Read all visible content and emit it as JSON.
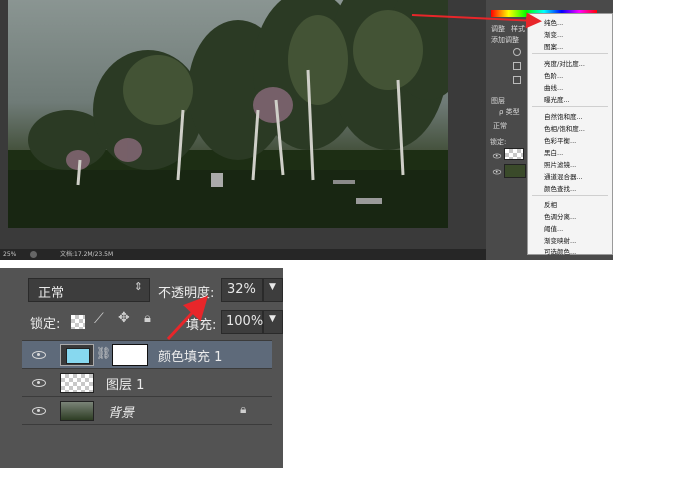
{
  "top_screenshot": {
    "status": {
      "zoom": "25%",
      "doc_info": "文档:17.2M/23.5M"
    },
    "panel": {
      "tab_adjust": "调整",
      "tab_style": "样式",
      "add_adjustment": "添加调整",
      "layers_tab": "图层",
      "kind_label": "ρ 类型",
      "blend_mini": "正常",
      "lock_mini": "锁定:"
    },
    "adjustment_menu": {
      "items": [
        "纯色...",
        "渐变...",
        "图案...",
        "亮度/对比度...",
        "色阶...",
        "曲线...",
        "曝光度...",
        "自然饱和度...",
        "色相/饱和度...",
        "色彩平衡...",
        "黑白...",
        "照片滤镜...",
        "通道混合器...",
        "颜色查找...",
        "反相",
        "色调分离...",
        "阈值...",
        "渐变映射...",
        "可选颜色..."
      ]
    }
  },
  "layers_panel": {
    "blend_mode": "正常",
    "opacity_label": "不透明度:",
    "opacity_value": "32%",
    "lock_label": "锁定:",
    "fill_label": "填充:",
    "fill_value": "100%",
    "fill_layer_color": "#87d8ef",
    "layers": [
      {
        "name": "颜色填充 1",
        "selected": true
      },
      {
        "name": "图层 1",
        "selected": false
      },
      {
        "name": "背景",
        "selected": false,
        "locked": true
      }
    ]
  },
  "colors": {
    "arrow": "#e8262a",
    "selected_row": "#5e6a7a",
    "panel_bg": "#535353"
  }
}
